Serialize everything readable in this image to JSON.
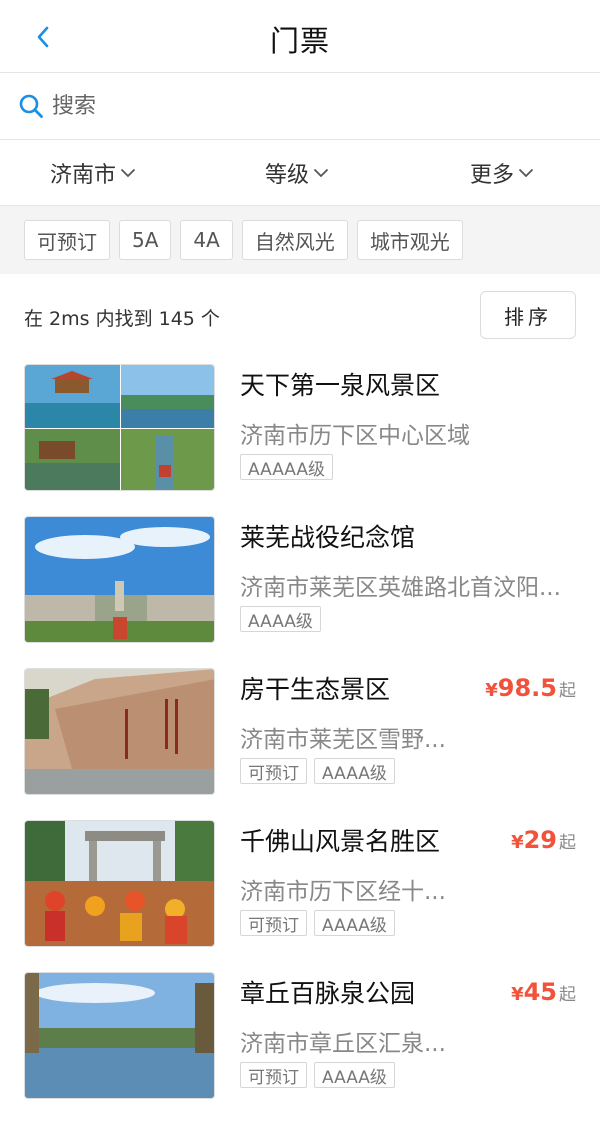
{
  "header": {
    "title": "门票"
  },
  "search": {
    "placeholder": "搜索"
  },
  "filters": {
    "city": "济南市",
    "level": "等级",
    "more": "更多"
  },
  "tags": [
    "可预订",
    "5A",
    "4A",
    "自然风光",
    "城市观光"
  ],
  "result": {
    "summary": "在 2ms 内找到 145 个",
    "sort_label": "排序"
  },
  "items": [
    {
      "name": "天下第一泉风景区",
      "address": "济南市历下区中心区域",
      "tags": [
        "AAAAA级"
      ],
      "price_currency": "",
      "price": "",
      "price_suffix": ""
    },
    {
      "name": "莱芜战役纪念馆",
      "address": "济南市莱芜区英雄路北首汶阳...",
      "tags": [
        "AAAA级"
      ],
      "price_currency": "",
      "price": "",
      "price_suffix": ""
    },
    {
      "name": "房干生态景区",
      "address": "济南市莱芜区雪野...",
      "tags": [
        "可预订",
        "AAAA级"
      ],
      "price_currency": "¥",
      "price": "98.5",
      "price_suffix": "起"
    },
    {
      "name": "千佛山风景名胜区",
      "address": "济南市历下区经十...",
      "tags": [
        "可预订",
        "AAAA级"
      ],
      "price_currency": "¥",
      "price": "29",
      "price_suffix": "起"
    },
    {
      "name": "章丘百脉泉公园",
      "address": "济南市章丘区汇泉...",
      "tags": [
        "可预订",
        "AAAA级"
      ],
      "price_currency": "¥",
      "price": "45",
      "price_suffix": "起"
    }
  ],
  "colors": {
    "accent": "#1a8fe3",
    "price": "#f2513a"
  }
}
